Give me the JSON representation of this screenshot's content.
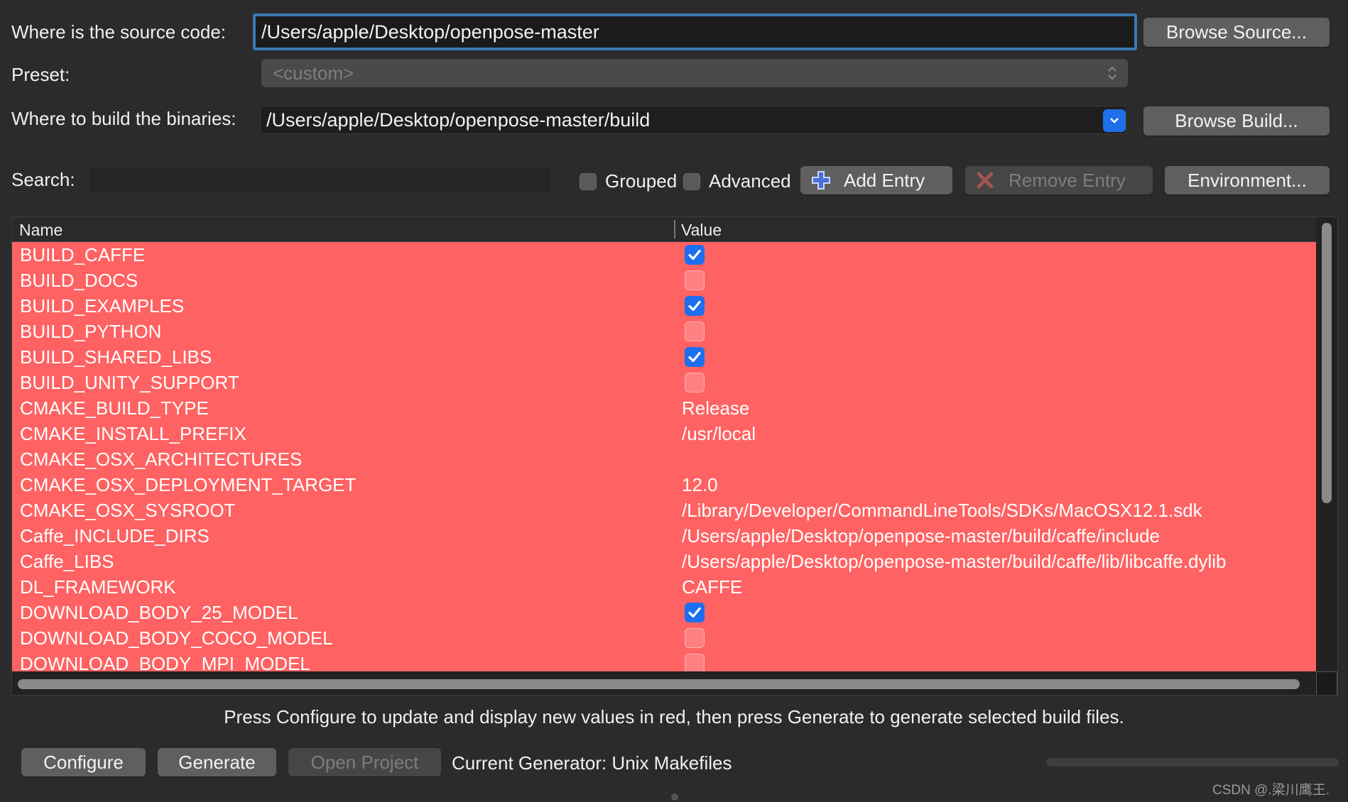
{
  "source": {
    "label": "Where is the source code:",
    "value": "/Users/apple/Desktop/openpose-master",
    "browse_label": "Browse Source..."
  },
  "preset": {
    "label": "Preset:",
    "value": "<custom>"
  },
  "build": {
    "label": "Where to build the binaries:",
    "value": "/Users/apple/Desktop/openpose-master/build",
    "browse_label": "Browse Build..."
  },
  "search": {
    "label": "Search:",
    "value": ""
  },
  "options": {
    "grouped_label": "Grouped",
    "advanced_label": "Advanced",
    "add_entry_label": "Add Entry",
    "remove_entry_label": "Remove Entry",
    "environment_label": "Environment..."
  },
  "table": {
    "headers": {
      "name": "Name",
      "value": "Value"
    },
    "rows": [
      {
        "name": "BUILD_CAFFE",
        "type": "bool",
        "checked": true
      },
      {
        "name": "BUILD_DOCS",
        "type": "bool",
        "checked": false
      },
      {
        "name": "BUILD_EXAMPLES",
        "type": "bool",
        "checked": true
      },
      {
        "name": "BUILD_PYTHON",
        "type": "bool",
        "checked": false
      },
      {
        "name": "BUILD_SHARED_LIBS",
        "type": "bool",
        "checked": true
      },
      {
        "name": "BUILD_UNITY_SUPPORT",
        "type": "bool",
        "checked": false
      },
      {
        "name": "CMAKE_BUILD_TYPE",
        "type": "text",
        "value": "Release"
      },
      {
        "name": "CMAKE_INSTALL_PREFIX",
        "type": "text",
        "value": "/usr/local"
      },
      {
        "name": "CMAKE_OSX_ARCHITECTURES",
        "type": "text",
        "value": ""
      },
      {
        "name": "CMAKE_OSX_DEPLOYMENT_TARGET",
        "type": "text",
        "value": "12.0"
      },
      {
        "name": "CMAKE_OSX_SYSROOT",
        "type": "text",
        "value": "/Library/Developer/CommandLineTools/SDKs/MacOSX12.1.sdk"
      },
      {
        "name": "Caffe_INCLUDE_DIRS",
        "type": "text",
        "value": "/Users/apple/Desktop/openpose-master/build/caffe/include"
      },
      {
        "name": "Caffe_LIBS",
        "type": "text",
        "value": "/Users/apple/Desktop/openpose-master/build/caffe/lib/libcaffe.dylib"
      },
      {
        "name": "DL_FRAMEWORK",
        "type": "text",
        "value": "CAFFE"
      },
      {
        "name": "DOWNLOAD_BODY_25_MODEL",
        "type": "bool",
        "checked": true
      },
      {
        "name": "DOWNLOAD_BODY_COCO_MODEL",
        "type": "bool",
        "checked": false
      },
      {
        "name": "DOWNLOAD_BODY_MPI_MODEL",
        "type": "bool",
        "checked": false
      }
    ]
  },
  "status_text": "Press Configure to update and display new values in red, then press Generate to generate selected build files.",
  "footer": {
    "configure_label": "Configure",
    "generate_label": "Generate",
    "open_project_label": "Open Project",
    "generator_text": "Current Generator: Unix Makefiles"
  },
  "watermark": "CSDN @.梁川鹰王.",
  "colors": {
    "changed_row": "#ff6262",
    "checkbox_on": "#1d6ff0",
    "focus_ring": "#3a78b5"
  }
}
